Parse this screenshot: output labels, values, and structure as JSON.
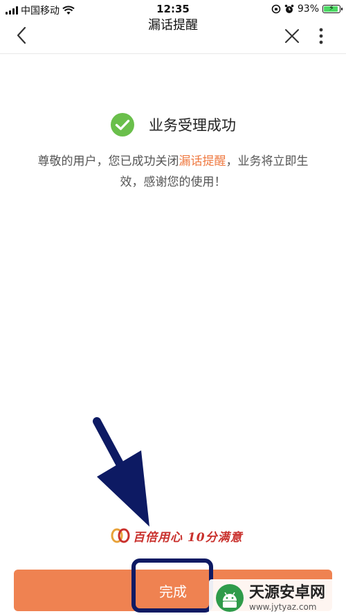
{
  "status_bar": {
    "carrier": "中国移动",
    "time": "12:35",
    "battery": "93%",
    "battery_level": 0.93
  },
  "nav": {
    "title": "漏话提醒",
    "back_icon": "chevron-left-icon",
    "close_icon": "close-icon",
    "more_icon": "more-vertical-icon"
  },
  "result": {
    "icon": "check-circle-icon",
    "title": "业务受理成功",
    "message_part1": "尊敬的用户，您已成功关闭",
    "message_highlight": "漏话提醒",
    "message_part2": "，业务将立即生效，感谢您的使用！"
  },
  "brand": {
    "slogan": "百倍用心 10分满意"
  },
  "footer": {
    "done_label": "完成"
  },
  "watermark": {
    "name": "天源安卓网",
    "url": "www.jytyaz.com"
  },
  "colors": {
    "accent": "#ef8251",
    "highlight_text": "#ef7a42",
    "success": "#6abf4b",
    "annotation": "#0d1a63"
  }
}
